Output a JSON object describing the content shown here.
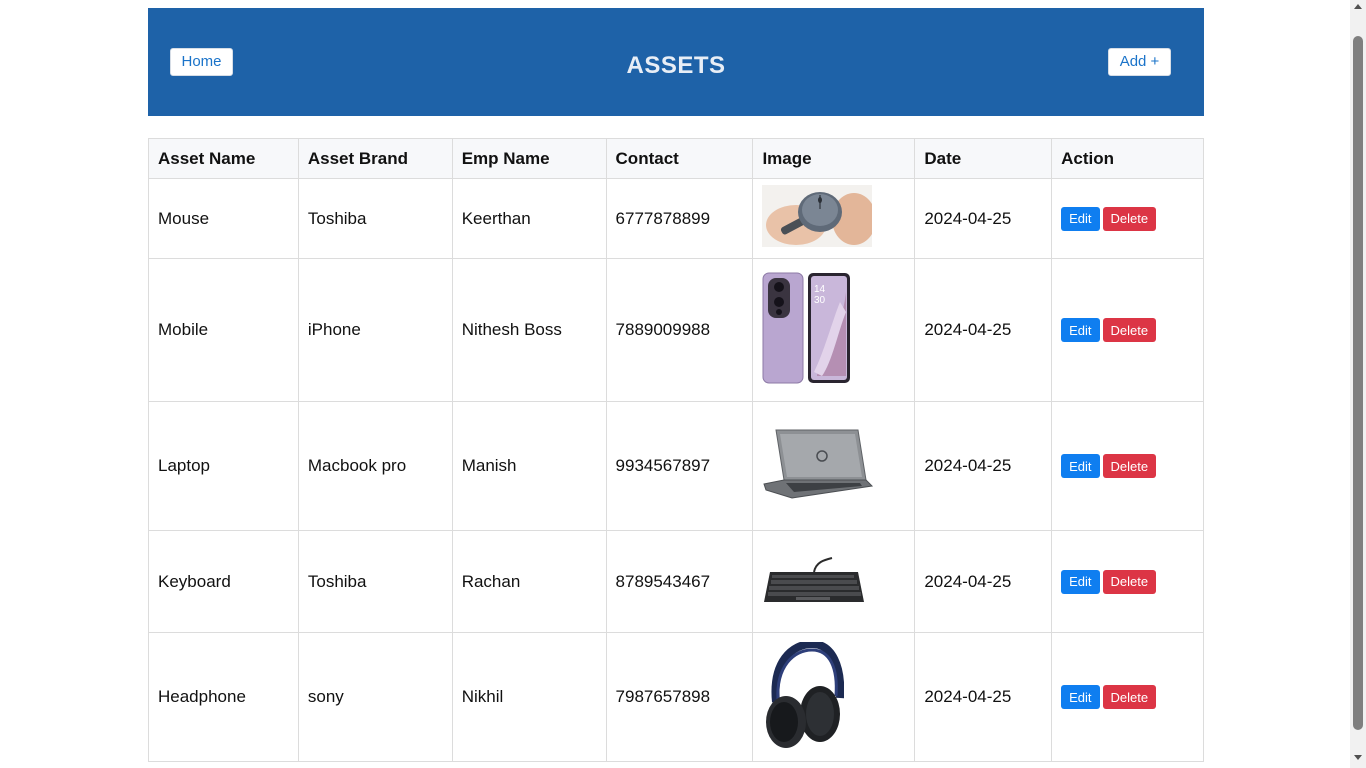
{
  "header": {
    "home_label": "Home",
    "title": "ASSETS",
    "add_label": "Add +",
    "background_color": "#1e62a8"
  },
  "table": {
    "columns": [
      "Asset Name",
      "Asset Brand",
      "Emp Name",
      "Contact",
      "Image",
      "Date",
      "Action"
    ],
    "rows": [
      {
        "asset_name": "Mouse",
        "brand": "Toshiba",
        "emp_name": "Keerthan",
        "contact": "6777878899",
        "image": "mouse-photo",
        "date": "2024-04-25",
        "edit_label": "Edit",
        "delete_label": "Delete"
      },
      {
        "asset_name": "Mobile",
        "brand": "iPhone",
        "emp_name": "Nithesh Boss",
        "contact": "7889009988",
        "image": "mobile-photo",
        "date": "2024-04-25",
        "edit_label": "Edit",
        "delete_label": "Delete"
      },
      {
        "asset_name": "Laptop",
        "brand": "Macbook pro",
        "emp_name": "Manish",
        "contact": "9934567897",
        "image": "laptop-photo",
        "date": "2024-04-25",
        "edit_label": "Edit",
        "delete_label": "Delete"
      },
      {
        "asset_name": "Keyboard",
        "brand": "Toshiba",
        "emp_name": "Rachan",
        "contact": "8789543467",
        "image": "keyboard-photo",
        "date": "2024-04-25",
        "edit_label": "Edit",
        "delete_label": "Delete"
      },
      {
        "asset_name": "Headphone",
        "brand": "sony",
        "emp_name": "Nikhil",
        "contact": "7987657898",
        "image": "headphone-photo",
        "date": "2024-04-25",
        "edit_label": "Edit",
        "delete_label": "Delete"
      }
    ]
  },
  "colors": {
    "edit_button": "#0f7ef0",
    "delete_button": "#dc3545",
    "link_text": "#1a73c9"
  }
}
